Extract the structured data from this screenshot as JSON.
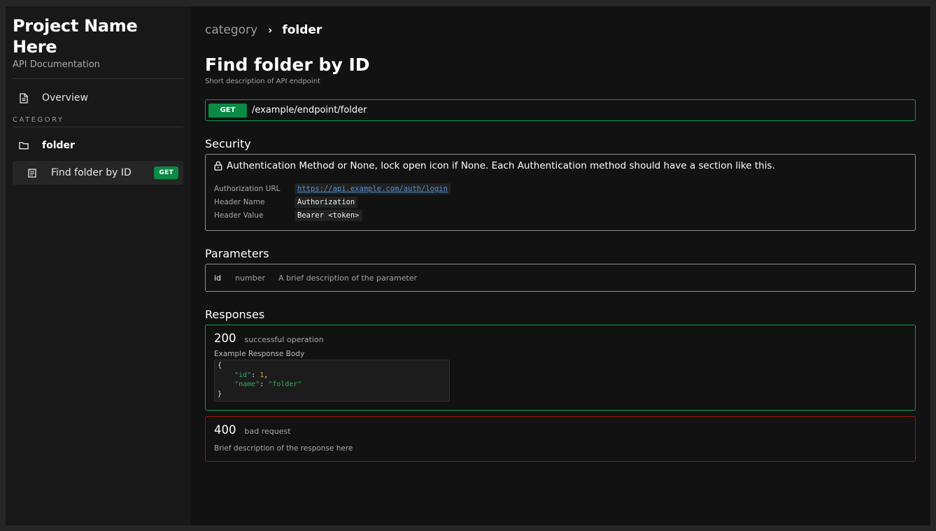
{
  "sidebar": {
    "project_title": "Project Name Here",
    "project_subtitle": "API Documentation",
    "overview_label": "Overview",
    "category_label": "CATEGORY",
    "folder_label": "folder",
    "endpoint_label": "Find folder by ID",
    "endpoint_method": "GET"
  },
  "breadcrumb": {
    "category": "category",
    "separator": "›",
    "current": "folder"
  },
  "endpoint": {
    "title": "Find folder by ID",
    "description": "Short description of API endpoint",
    "method": "GET",
    "path": "/example/endpoint/folder"
  },
  "security": {
    "title": "Security",
    "heading": "Authentication Method or None, lock open icon if None. Each Authentication method should have a section like this.",
    "rows": [
      {
        "key": "Authorization URL",
        "value": "https://api.example.com/auth/login"
      },
      {
        "key": "Header Name",
        "value": "Authorization"
      },
      {
        "key": "Header Value",
        "value": "Bearer <token>"
      }
    ]
  },
  "parameters": {
    "title": "Parameters",
    "items": [
      {
        "name": "id",
        "type": "number",
        "description": "A brief description of the parameter"
      }
    ]
  },
  "responses": {
    "title": "Responses",
    "items": [
      {
        "code": "200",
        "text": "successful operation",
        "body_label": "Example Response Body",
        "body": {
          "open": "{",
          "id_key": "\"id\"",
          "id_value": "1",
          "name_key": "\"name\"",
          "name_value": "\"folder\"",
          "close": "}"
        }
      },
      {
        "code": "400",
        "text": "bad request",
        "description": "Brief description of the response here"
      }
    ]
  },
  "colors": {
    "accent_green": "#0b8a45",
    "error_red": "#a41414",
    "link_blue": "#4f8fd6"
  },
  "icons": {
    "overview": "document-icon",
    "folder": "folder-icon",
    "endpoint": "list-document-icon",
    "security": "lock-icon"
  }
}
